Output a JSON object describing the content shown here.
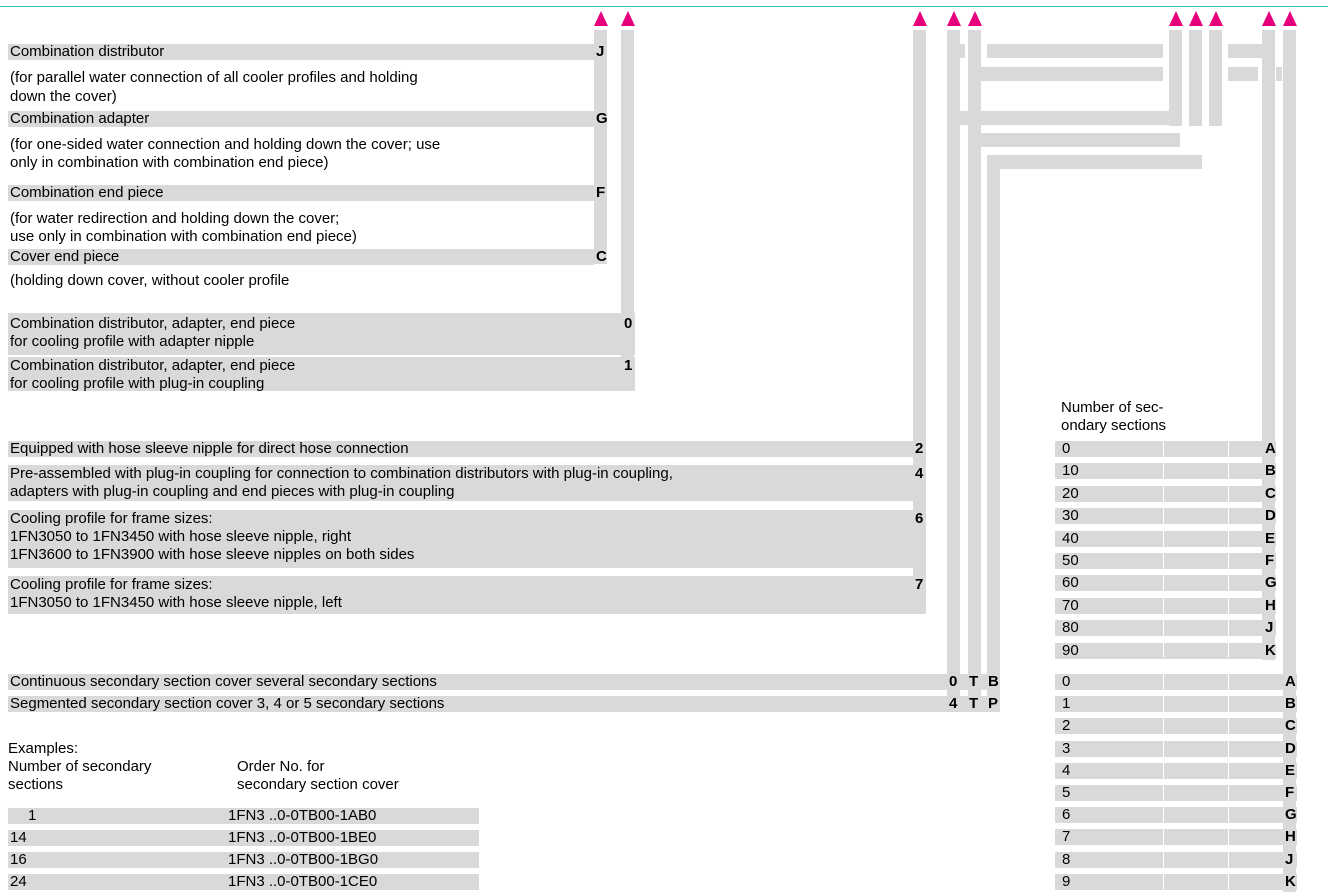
{
  "distributor_section": [
    {
      "label": "Combination distributor",
      "desc": [
        "(for parallel water connection of all cooler profiles and holding",
        "down the cover)"
      ],
      "code": "J"
    },
    {
      "label": "Combination adapter",
      "desc": [
        "(for one-sided water connection and holding down the cover; use",
        "only in combination with combination end piece)"
      ],
      "code": "G"
    },
    {
      "label": "Combination end piece",
      "desc": [
        "(for water redirection and holding down the cover;",
        "use only in combination with combination end piece)"
      ],
      "code": "F"
    },
    {
      "label": "Cover end piece",
      "desc": [
        "(holding down cover, without cooler profile"
      ],
      "code": "C"
    }
  ],
  "coupling_section": [
    {
      "lines": [
        "Combination distributor, adapter, end piece",
        "for cooling profile with adapter nipple"
      ],
      "code": "0"
    },
    {
      "lines": [
        "Combination distributor, adapter, end piece",
        "for cooling profile with plug-in coupling"
      ],
      "code": "1"
    }
  ],
  "profile_section": [
    {
      "lines": [
        "Equipped with hose sleeve nipple for direct hose connection"
      ],
      "code": "2"
    },
    {
      "lines": [
        "Pre-assembled with plug-in coupling for connection to combination distributors with plug-in coupling,",
        "adapters with plug-in coupling and end pieces with plug-in coupling"
      ],
      "code": "4"
    },
    {
      "lines": [
        "Cooling profile for frame sizes:",
        "1FN3050 to 1FN3450 with hose sleeve nipple, right",
        "1FN3600 to 1FN3900 with hose sleeve nipples on both sides"
      ],
      "code": "6"
    },
    {
      "lines": [
        "Cooling profile for frame sizes:",
        "1FN3050 to 1FN3450 with hose sleeve nipple, left"
      ],
      "code": "7"
    }
  ],
  "cover_section": [
    {
      "label": "Continuous secondary section cover several secondary sections",
      "codes": [
        "0",
        "T",
        "B"
      ]
    },
    {
      "label": "Segmented secondary section cover 3, 4 or 5 secondary sections",
      "codes": [
        "4",
        "T",
        "P"
      ]
    }
  ],
  "tens_table": {
    "header": [
      "Number of sec-",
      "ondary sections"
    ],
    "rows": [
      {
        "value": "0",
        "code": "A"
      },
      {
        "value": "10",
        "code": "B"
      },
      {
        "value": "20",
        "code": "C"
      },
      {
        "value": "30",
        "code": "D"
      },
      {
        "value": "40",
        "code": "E"
      },
      {
        "value": "50",
        "code": "F"
      },
      {
        "value": "60",
        "code": "G"
      },
      {
        "value": "70",
        "code": "H"
      },
      {
        "value": "80",
        "code": "J"
      },
      {
        "value": "90",
        "code": "K"
      }
    ]
  },
  "units_table": {
    "rows": [
      {
        "value": "0",
        "code": "A"
      },
      {
        "value": "1",
        "code": "B"
      },
      {
        "value": "2",
        "code": "C"
      },
      {
        "value": "3",
        "code": "D"
      },
      {
        "value": "4",
        "code": "E"
      },
      {
        "value": "5",
        "code": "F"
      },
      {
        "value": "6",
        "code": "G"
      },
      {
        "value": "7",
        "code": "H"
      },
      {
        "value": "8",
        "code": "J"
      },
      {
        "value": "9",
        "code": "K"
      }
    ]
  },
  "examples": {
    "title": "Examples:",
    "col1_header": [
      "Number of secondary",
      "sections"
    ],
    "col2_header": [
      "Order No. for",
      "secondary section cover"
    ],
    "rows": [
      {
        "n": "1",
        "order": "1FN3 ..0-0TB00-1AB0"
      },
      {
        "n": "14",
        "order": "1FN3 ..0-0TB00-1BE0"
      },
      {
        "n": "16",
        "order": "1FN3 ..0-0TB00-1BG0"
      },
      {
        "n": "24",
        "order": "1FN3 ..0-0TB00-1CE0"
      }
    ]
  },
  "colors": {
    "accent_arrow": "#e6007e",
    "top_rule": "#33c7cc",
    "band": "#d9d9d9"
  }
}
